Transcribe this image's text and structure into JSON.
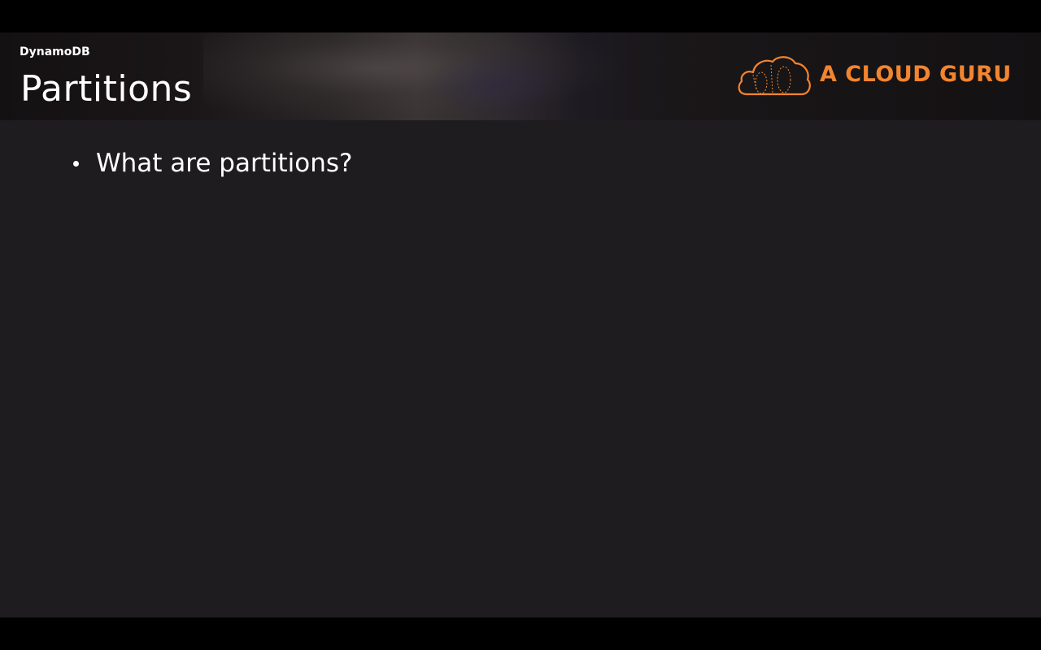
{
  "slide": {
    "section_label": "DynamoDB",
    "title": "Partitions",
    "logo": {
      "icon": "cloud-icon",
      "text": "A CLOUD GURU",
      "color": "#f2852f"
    },
    "bullets": [
      {
        "text": "What are partitions?"
      }
    ]
  },
  "colors": {
    "background": "#1f1c20",
    "letterbox": "#000000",
    "text": "#ffffff",
    "accent": "#f2852f"
  }
}
